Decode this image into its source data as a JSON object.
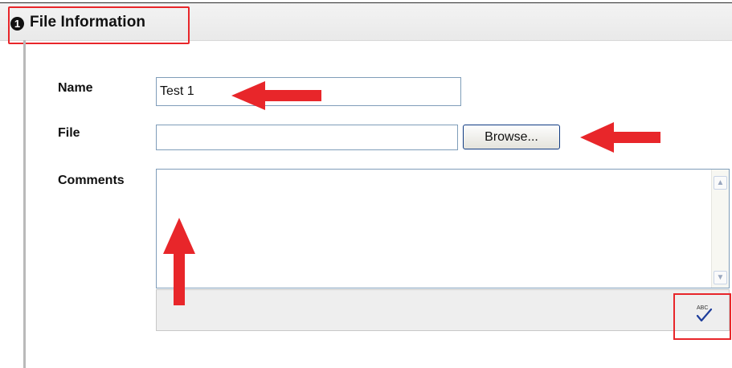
{
  "section": {
    "step_number": "1",
    "title": "File Information"
  },
  "form": {
    "name_label": "Name",
    "name_value": "Test 1",
    "file_label": "File",
    "file_value": "",
    "browse_label": "Browse...",
    "comments_label": "Comments",
    "comments_value": ""
  },
  "spellcheck": {
    "icon": "abc-spellcheck-icon",
    "icon_text": "ABC"
  },
  "colors": {
    "highlight": "#e8262a",
    "arrow": "#e8262a",
    "input_border": "#7f9db9",
    "button_border": "#0f3a82"
  }
}
